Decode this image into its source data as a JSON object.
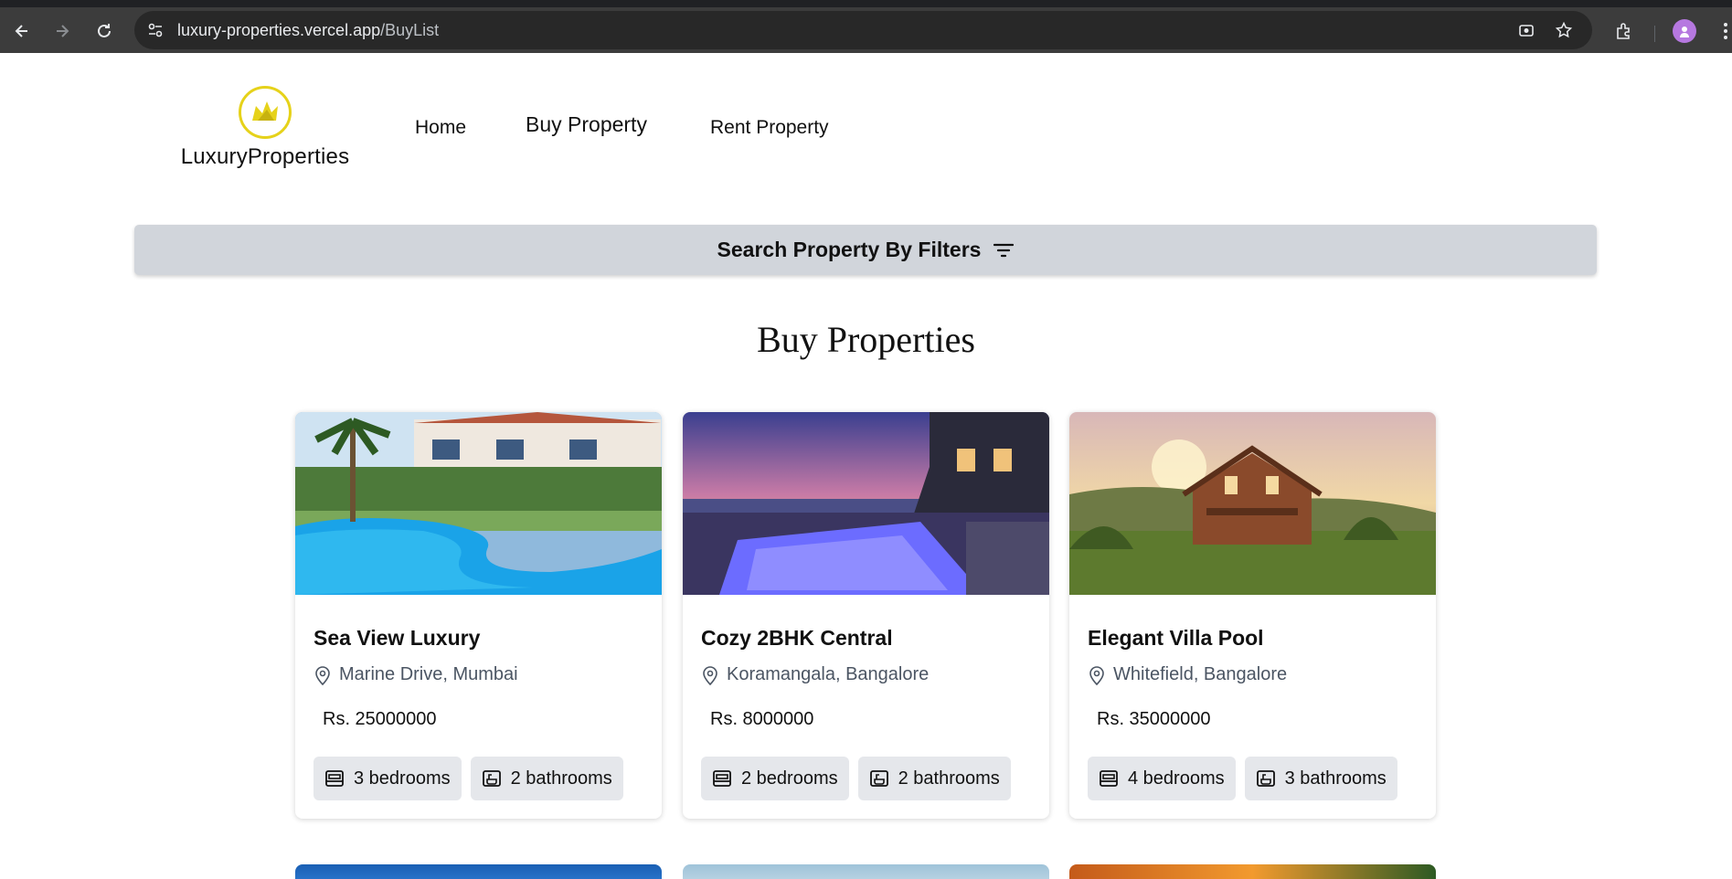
{
  "browser": {
    "url_host": "luxury-properties.vercel.app",
    "url_path": "/BuyList"
  },
  "header": {
    "logo_text": "LuxuryProperties",
    "nav": [
      {
        "label": "Home"
      },
      {
        "label": "Buy Property"
      },
      {
        "label": "Rent Property"
      }
    ]
  },
  "filter": {
    "label": "Search Property By Filters"
  },
  "main": {
    "title": "Buy Properties",
    "listings": [
      {
        "title": "Sea View Luxury",
        "location": "Marine Drive, Mumbai",
        "price": "Rs. 25000000",
        "bedrooms": "3 bedrooms",
        "bathrooms": "2 bathrooms"
      },
      {
        "title": "Cozy 2BHK Central",
        "location": "Koramangala, Bangalore",
        "price": "Rs. 8000000",
        "bedrooms": "2 bedrooms",
        "bathrooms": "2 bathrooms"
      },
      {
        "title": "Elegant Villa Pool",
        "location": "Whitefield, Bangalore",
        "price": "Rs. 35000000",
        "bedrooms": "4 bedrooms",
        "bathrooms": "3 bathrooms"
      }
    ]
  },
  "colors": {
    "logo_accent": "#e6d21a",
    "filter_bar": "#d1d5db",
    "chip_bg": "#e5e7eb"
  }
}
